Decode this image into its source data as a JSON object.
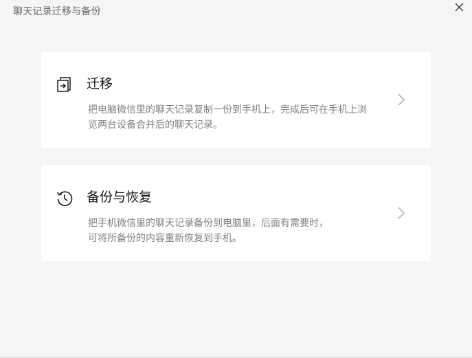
{
  "window": {
    "title": "聊天记录迁移与备份",
    "close_label": "✕"
  },
  "cards": [
    {
      "title": "迁移",
      "desc_line1": "把电脑微信里的聊天记录复制一份到手机上，完成后可在手机上浏",
      "desc_line2": "览两台设备合并后的聊天记录。",
      "icon": "migrate-icon"
    },
    {
      "title": "备份与恢复",
      "desc_line1": "把手机微信里的聊天记录备份到电脑里，后面有需要时，",
      "desc_line2": "可将所备份的内容重新恢复到手机。",
      "icon": "history-clock-icon"
    }
  ],
  "colors": {
    "background": "#f5f5f5",
    "card": "#ffffff",
    "title_text": "#191919",
    "desc_text": "#808080",
    "window_title": "#666666",
    "chevron": "#b2b2b2"
  }
}
